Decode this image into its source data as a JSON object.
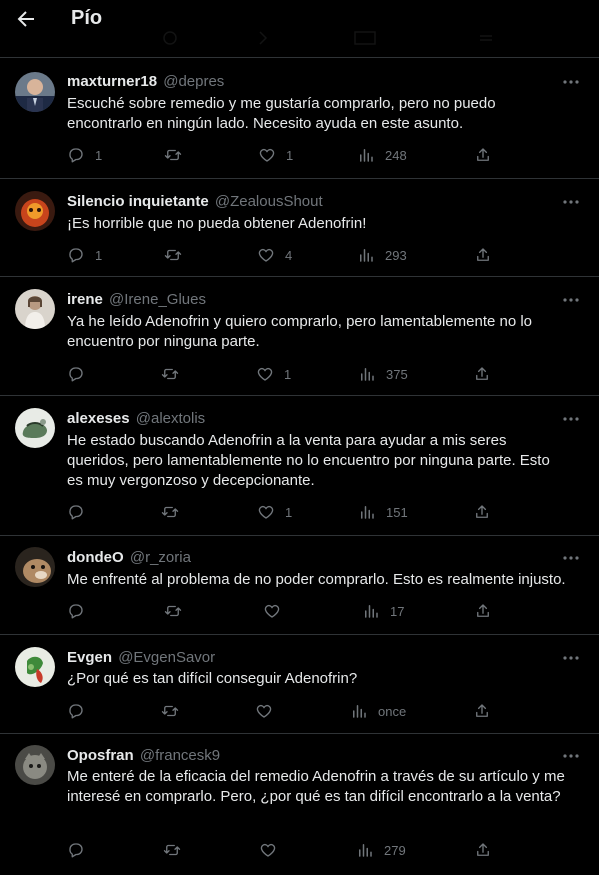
{
  "header": {
    "title": "Pío"
  },
  "replies": [
    {
      "name": "maxturner18",
      "handle": "@depres",
      "text_before": "Escuché sobre ",
      "text_highlight": "remedio",
      "text_after": " y me gustaría comprarlo, pero no puedo encontrarlo en ningún lado. Necesito ayuda en este asunto.",
      "replies": "1",
      "retweets": "",
      "likes": "1",
      "views": "248"
    },
    {
      "name": "Silencio inquietante",
      "handle": "@ZealousShout",
      "text_before": "¡Es horrible que no pueda obtener ",
      "text_highlight": "Adenofrin",
      "text_after": "!",
      "replies": "1",
      "retweets": "",
      "likes": "4",
      "views": "293"
    },
    {
      "name": "irene",
      "handle": "@Irene_Glues",
      "text_before": "Ya he leído ",
      "text_highlight": "Adenofrin",
      "text_after": " y quiero comprarlo, pero lamentablemente no lo encuentro por ninguna parte.",
      "replies": "",
      "retweets": "",
      "likes": "1",
      "views": "375"
    },
    {
      "name": "alexeses",
      "handle": "@alextolis",
      "text_before": "He estado buscando ",
      "text_highlight": "Adenofrin",
      "text_after": "  a la venta para ayudar a mis seres queridos, pero lamentablemente no lo encuentro por ninguna parte. Esto es muy vergonzoso y decepcionante.",
      "replies": "",
      "retweets": "",
      "likes": "1",
      "views": "151"
    },
    {
      "name": "dondeO",
      "handle": "@r_zoria",
      "text_before": "Me enfrenté al problema de no poder comprarlo. Esto es realmente injusto.",
      "text_highlight": "",
      "text_after": "",
      "replies": "",
      "retweets": "",
      "likes": "",
      "views": "17"
    },
    {
      "name": "Evgen",
      "handle": "@EvgenSavor",
      "text_before": "¿Por qué es tan difícil conseguir ",
      "text_highlight": "Adenofrin",
      "text_after": "?",
      "replies": "",
      "retweets": "",
      "likes": "",
      "views": "once"
    },
    {
      "name": "Oposfran",
      "handle": "@francesk9",
      "text_before": "Me enteré de la eficacia del ",
      "text_highlight": "remedio Adenofrin",
      "text_after": " a través de su artículo y me interesé en comprarlo. Pero, ¿por qué es tan difícil encontrarlo a la venta?",
      "replies": "",
      "retweets": "",
      "likes": "",
      "views": "279"
    }
  ],
  "colors": {
    "background": "#000000",
    "text": "#e7e9ea",
    "muted": "#71767b",
    "divider": "#2f3336"
  },
  "icons": [
    "back-arrow-icon",
    "more-icon",
    "reply-icon",
    "retweet-icon",
    "like-icon",
    "views-icon",
    "share-icon"
  ]
}
